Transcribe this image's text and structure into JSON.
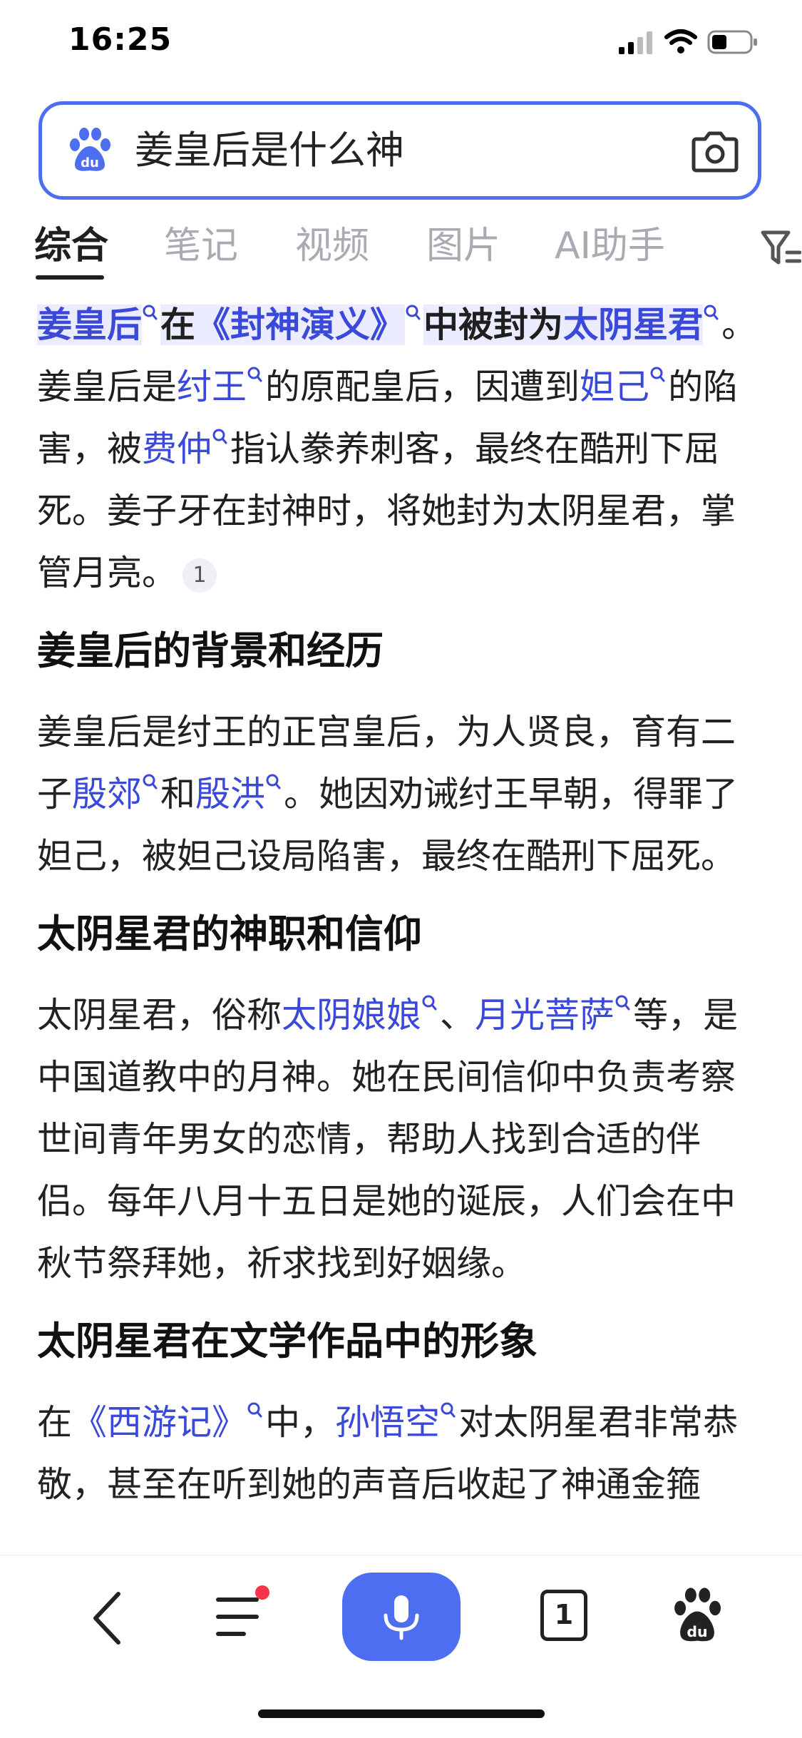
{
  "status_bar": {
    "time": "16:25"
  },
  "search": {
    "query": "姜皇后是什么神",
    "logo_icon": "baidu-paw-icon",
    "camera_icon": "camera-icon"
  },
  "tabs": [
    {
      "label": "综合",
      "active": true
    },
    {
      "label": "笔记"
    },
    {
      "label": "视频"
    },
    {
      "label": "图片"
    },
    {
      "label": "AI助手"
    }
  ],
  "answer": {
    "lead_parts": [
      "姜皇后",
      "在",
      "《封神演义》",
      "中被封为",
      "太阴星君"
    ],
    "p1_parts": [
      "。姜皇后是",
      "纣王",
      "的原配皇后，因遭到",
      "妲己",
      "的陷害，被",
      "费仲",
      "指认豢养刺客，最终在酷刑下屈死。姜子牙在封神时，将她封为太阴星君，掌管月亮。"
    ],
    "citation": "1",
    "section1_title": "姜皇后的背景和经历",
    "p2_parts": [
      "姜皇后是纣王的正宫皇后，为人贤良，育有二子",
      "殷郊",
      "和",
      "殷洪",
      "。她因劝诫纣王早朝，得罪了妲己，被妲己设局陷害，最终在酷刑下屈死。"
    ],
    "section2_title": "太阴星君的神职和信仰",
    "p3_parts": [
      "太阴星君，俗称",
      "太阴娘娘",
      "、",
      "月光菩萨",
      "等，是中国道教中的月神。她在民间信仰中负责考察世间青年男女的恋情，帮助人找到合适的伴侣。每年八月十五日是她的诞辰，人们会在中秋节祭拜她，祈求找到好姻缘。"
    ],
    "section3_title": "太阴星君在文学作品中的形象",
    "p4_parts": [
      "在",
      "《西游记》",
      "中，",
      "孙悟空",
      "对太阴星君非常恭敬，甚至在听到她的声音后收起了神通金箍"
    ]
  },
  "bottom_bar": {
    "tab_count": "1"
  },
  "colors": {
    "accent": "#4e6ef2",
    "link": "#3b49d8",
    "highlight": "#ebecff",
    "badge": "#f5334a"
  }
}
